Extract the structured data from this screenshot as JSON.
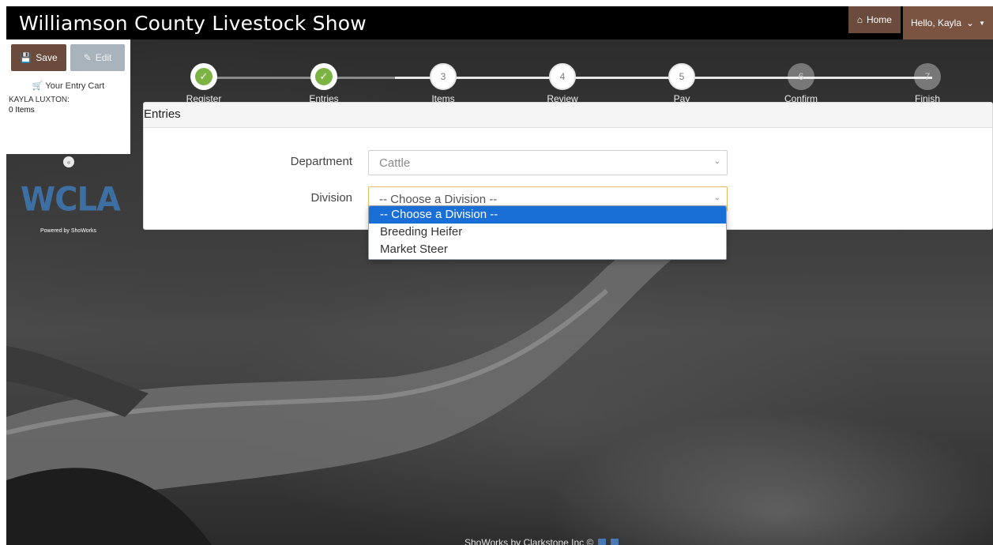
{
  "app": {
    "title": "Williamson County Livestock Show"
  },
  "nav": {
    "home_label": "Home",
    "user_label": "Hello, Kayla"
  },
  "sidebar": {
    "save_label": "Save",
    "edit_label": "Edit",
    "cart_label": "Your Entry Cart",
    "exhibitor_name": "KAYLA LUXTON:",
    "item_count": "0 Items",
    "logo_text": "WCLA",
    "powered_by": "Powered by ShoWorks"
  },
  "steps": [
    {
      "number": "1",
      "label": "Register",
      "state": "done"
    },
    {
      "number": "2",
      "label": "Entries",
      "state": "done"
    },
    {
      "number": "3",
      "label": "Items",
      "state": "todo"
    },
    {
      "number": "4",
      "label": "Review",
      "state": "todo"
    },
    {
      "number": "5",
      "label": "Pay",
      "state": "todo"
    },
    {
      "number": "6",
      "label": "Confirm",
      "state": "faint"
    },
    {
      "number": "7",
      "label": "Finish",
      "state": "faint"
    }
  ],
  "panel": {
    "title": "Entries",
    "department_label": "Department",
    "department_value": "Cattle",
    "division_label": "Division",
    "division_value": "-- Choose a Division --"
  },
  "division_options": [
    "-- Choose a Division --",
    "Breeding Heifer",
    "Market Steer"
  ],
  "footer": {
    "text": "ShoWorks by Clarkstone Inc ©"
  },
  "colors": {
    "brand_brown": "#6b4b3c",
    "step_done": "#7cb342",
    "selected_option": "#1a6fd6",
    "logo_blue": "#3e6fa3"
  }
}
